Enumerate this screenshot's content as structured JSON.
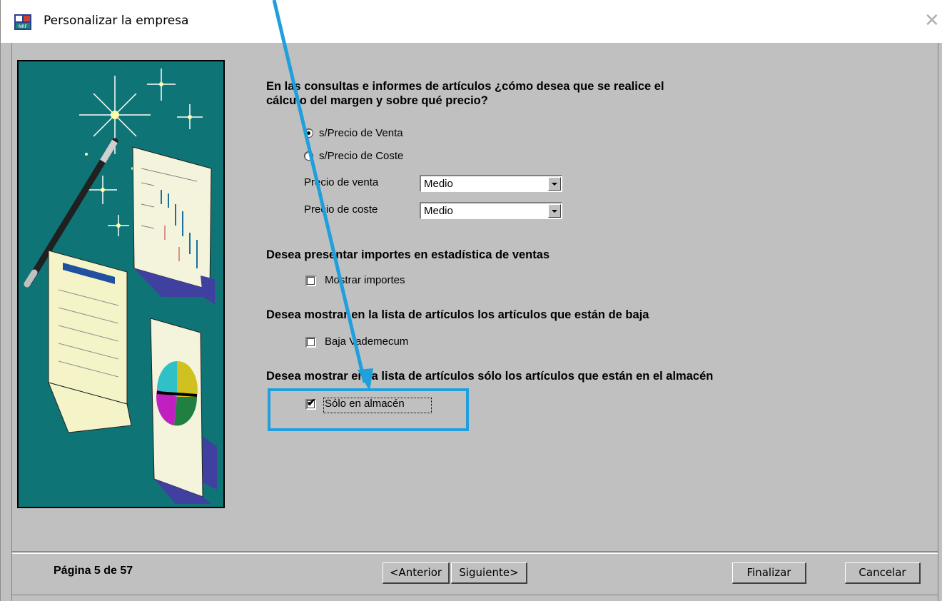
{
  "window": {
    "title": "Personalizar la empresa"
  },
  "questions": {
    "margin": {
      "line1": "En las consultas e informes de artículos ¿cómo desea que se realice el",
      "line2": "cálculo del margen  y sobre qué precio?"
    },
    "importes": "Desea presentar importes en estadística de ventas",
    "baja": "Desea mostrar en la lista de artículos los artículos que  están de baja",
    "almacen": "Desea mostrar en la lista de artículos sólo los artículos que están en el almacén"
  },
  "options": {
    "radio_venta": {
      "label": "s/Precio de Venta",
      "selected": true
    },
    "radio_coste": {
      "label": "s/Precio de Coste",
      "selected": false
    },
    "precio_venta": {
      "label": "Precio de venta",
      "value": "Medio"
    },
    "precio_coste": {
      "label": "Precio de coste",
      "value": "Medio"
    },
    "mostrar_importes": {
      "label": "Mostrar importes",
      "checked": false
    },
    "baja_vademecum": {
      "label": "Baja Vademecum",
      "checked": false
    },
    "solo_almacen": {
      "label": "Sólo en almacén",
      "checked": true
    }
  },
  "footer": {
    "page_label": "Página 5 de 57",
    "anterior": "<Anterior",
    "siguiente": "Siguiente>",
    "finalizar": "Finalizar",
    "cancelar": "Cancelar"
  },
  "colors": {
    "dialog_bg": "#c0c0c0",
    "illustration_bg": "#0f7476",
    "annotation": "#1fa0dc"
  },
  "icons": {
    "title": "wizard-app-icon",
    "close": "close-icon",
    "illustration": "magic-wand-reports-illustration"
  }
}
